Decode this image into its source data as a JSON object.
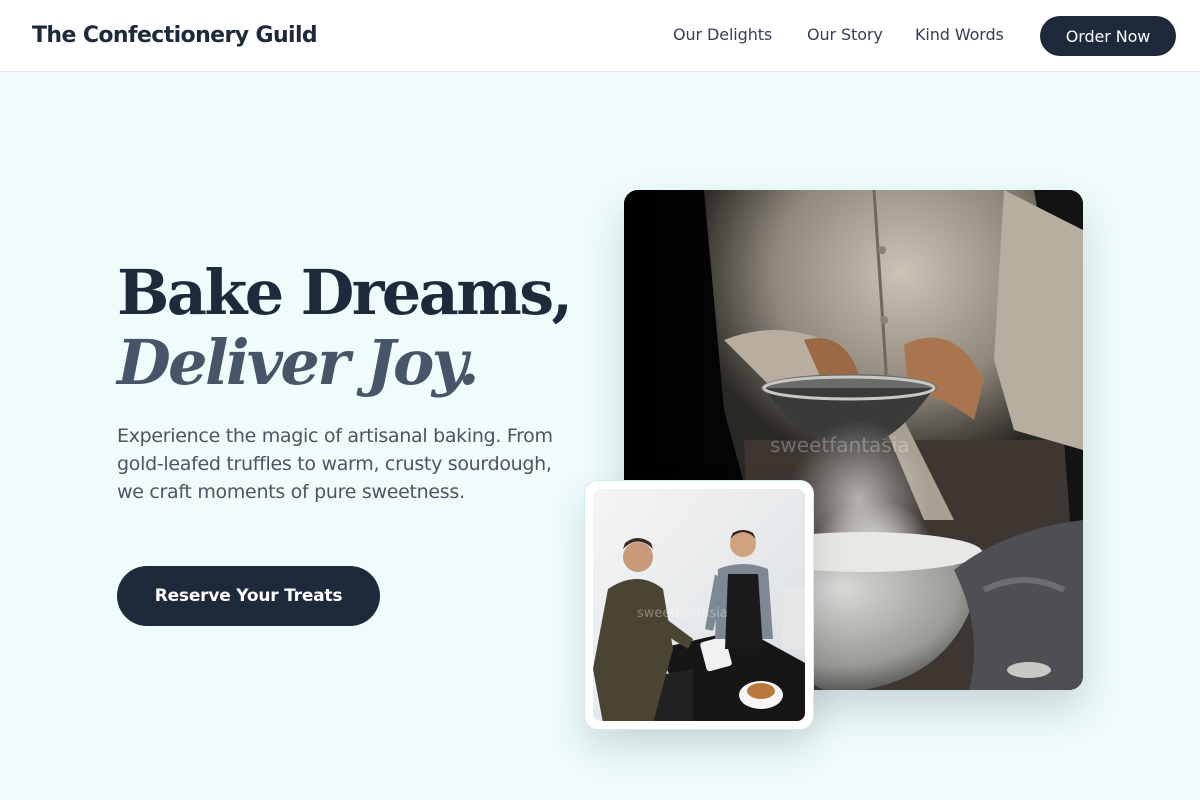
{
  "header": {
    "brand": "The Confectionery Guild",
    "nav": [
      {
        "label": "Our Delights"
      },
      {
        "label": "Our Story"
      },
      {
        "label": "Kind Words"
      }
    ],
    "order_label": "Order Now"
  },
  "hero": {
    "headline_line1": "Bake Dreams,",
    "headline_line2": "Deliver Joy.",
    "description": "Experience the magic of artisanal baking. From gold-leafed truffles to warm, crusty sourdough, we craft moments of pure sweetness.",
    "cta_label": "Reserve Your Treats"
  },
  "images": {
    "main_watermark": "sweetfantasia",
    "small_watermark": "sweetfantasia"
  },
  "colors": {
    "page_background": "#effcfb",
    "primary_dark": "#1e293b",
    "accent_slate": "#475569"
  }
}
